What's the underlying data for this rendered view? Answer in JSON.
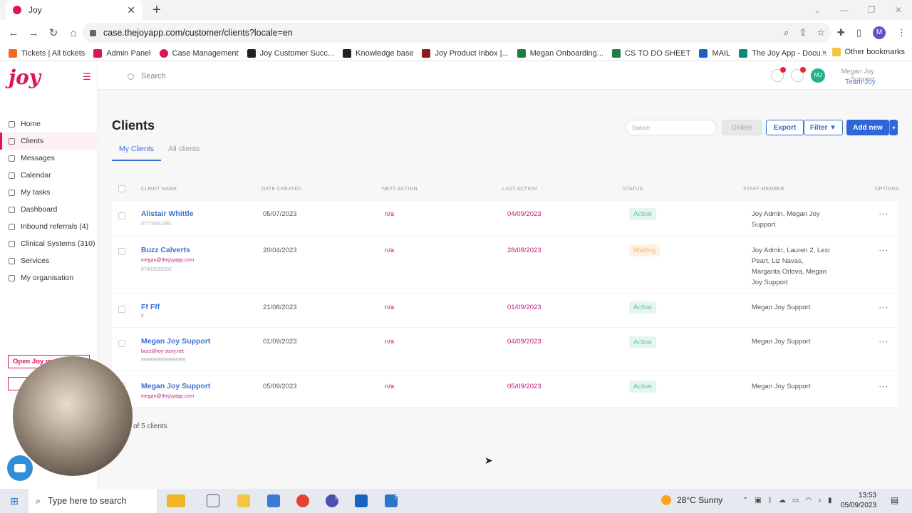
{
  "browser": {
    "tab_title": "Joy",
    "url": "case.thejoyapp.com/customer/clients?locale=en",
    "bookmarks": [
      "Tickets | All tickets",
      "Admin Panel",
      "Case Management",
      "Joy Customer Succ...",
      "Knowledge base",
      "Joy Product Inbox |...",
      "Megan Onboarding...",
      "CS TO DO SHEET",
      "MAIL",
      "The Joy App - Docu..."
    ],
    "other_bookmarks": "Other bookmarks",
    "profile_initial": "M"
  },
  "app": {
    "logo": "joy",
    "search_placeholder": "Search",
    "avatar_initials": "MJ",
    "user_name": "Megan Joy Support",
    "team": "Team Joy",
    "notification_badge": "1",
    "message_badge": "1"
  },
  "sidebar": {
    "items": [
      {
        "label": "Home"
      },
      {
        "label": "Clients"
      },
      {
        "label": "Messages"
      },
      {
        "label": "Calendar"
      },
      {
        "label": "My tasks"
      },
      {
        "label": "Dashboard"
      },
      {
        "label": "Inbound referrals (4)"
      },
      {
        "label": "Clinical Systems (310)"
      },
      {
        "label": "Services"
      },
      {
        "label": "My organisation"
      }
    ],
    "open_joy_label": "Open Joy m"
  },
  "page": {
    "title": "Clients",
    "tabs": [
      "My Clients",
      "All clients"
    ],
    "search_placeholder": "Search",
    "buttons": {
      "delete": "Delete",
      "export": "Export",
      "filter": "Filter",
      "add": "Add new",
      "caret": "▾"
    },
    "columns": [
      "CLIENT NAME",
      "DATE CREATED",
      "NEXT ACTION",
      "LAST ACTION",
      "STATUS",
      "STAFF MEMBER",
      "OPTIONS"
    ],
    "rows": [
      {
        "name": "Alistair Whittle",
        "email": "",
        "phone": "07776401381",
        "created": "05/07/2023",
        "next": "n/a",
        "last": "04/09/2023",
        "status": "Active",
        "staff": "Joy Admin, Megan Joy Support"
      },
      {
        "name": "Buzz Calverts",
        "email": "megan@thejoyapp.com",
        "phone": "07402535302",
        "created": "20/04/2023",
        "next": "n/a",
        "last": "28/08/2023",
        "status": "Waiting",
        "staff": "Joy Admin, Lauren 2, Lexi Peart, Liz Navas, Margarita Orlova, Megan Joy Support"
      },
      {
        "name": "Ff Fff",
        "email": "",
        "phone": "ff",
        "created": "21/08/2023",
        "next": "n/a",
        "last": "01/09/2023",
        "status": "Active",
        "staff": "Megan Joy Support"
      },
      {
        "name": "Megan Joy Support",
        "email": "buzz@toy-story.net",
        "phone": "9999999999999999",
        "created": "01/09/2023",
        "next": "n/a",
        "last": "04/09/2023",
        "status": "Active",
        "staff": "Megan Joy Support"
      },
      {
        "name": "Megan Joy Support",
        "email": "megan@thejoyapp.com",
        "phone": "",
        "created": "05/09/2023",
        "next": "n/a",
        "last": "05/09/2023",
        "status": "Active",
        "staff": "Megan Joy Support"
      }
    ],
    "count_text": "of 5 clients"
  },
  "taskbar": {
    "search": "Type here to search",
    "weather": "28°C  Sunny",
    "time": "13:53",
    "date": "05/09/2023",
    "chrome_badge": "8",
    "app_badge": "7"
  }
}
